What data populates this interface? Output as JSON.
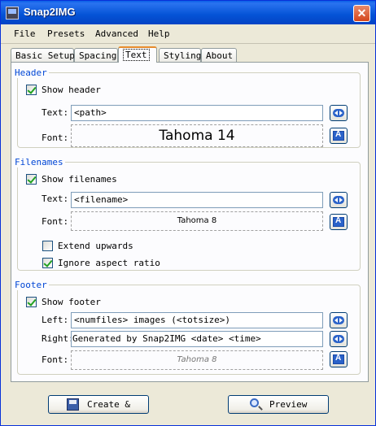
{
  "window": {
    "title": "Snap2IMG"
  },
  "menu": [
    {
      "label": "File"
    },
    {
      "label": "Presets"
    },
    {
      "label": "Advanced"
    },
    {
      "label": "Help"
    }
  ],
  "tabs": [
    {
      "label": "Basic Setup"
    },
    {
      "label": "Spacing"
    },
    {
      "label": "Text",
      "active": true
    },
    {
      "label": "Styling"
    },
    {
      "label": "About"
    }
  ],
  "header": {
    "legend": "Header",
    "show_label": "Show header",
    "show_checked": true,
    "text_label": "Text:",
    "text_value": "<path>",
    "font_label": "Font:",
    "font_sample": "Tahoma 14"
  },
  "filenames": {
    "legend": "Filenames",
    "show_label": "Show filenames",
    "show_checked": true,
    "text_label": "Text:",
    "text_value": "<filename>",
    "font_label": "Font:",
    "font_sample": "Tahoma 8",
    "extend_label": "Extend upwards",
    "extend_checked": false,
    "ignore_label": "Ignore aspect ratio",
    "ignore_checked": true
  },
  "footer": {
    "legend": "Footer",
    "show_label": "Show footer",
    "show_checked": true,
    "left_label": "Left:",
    "left_value": "<numfiles> images (<totsize>)",
    "right_label": "Right:",
    "right_value": "Generated by Snap2IMG  <date> <time>",
    "font_label": "Font:",
    "font_sample": "Tahoma 8"
  },
  "buttons": {
    "create": "Create &",
    "preview": "Preview"
  },
  "icons": {
    "app": "snap2img-app-icon",
    "close": "close-icon",
    "insert_variable": "arrows-icon",
    "font_picker": "font-icon",
    "create": "save-icon",
    "preview": "magnifier-icon"
  },
  "colors": {
    "title_bar": "#0453d6",
    "legend_text": "#0046d5",
    "active_tab_accent": "#e68b2c",
    "checkmark": "#21a121"
  }
}
